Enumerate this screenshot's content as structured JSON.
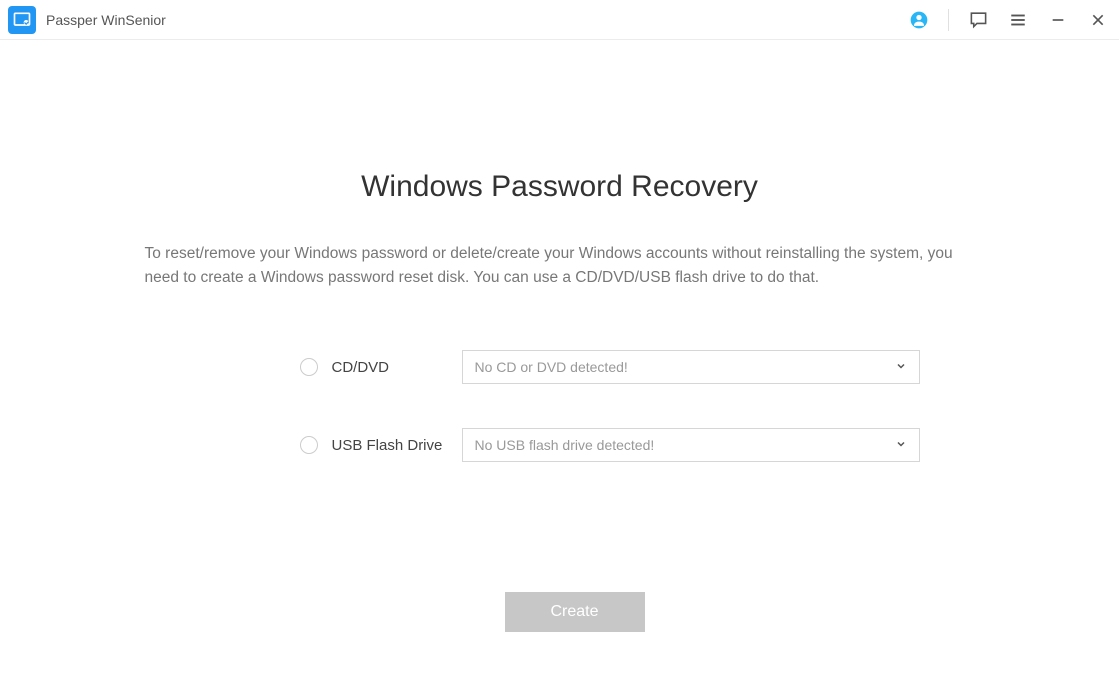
{
  "titlebar": {
    "app_name": "Passper WinSenior"
  },
  "main": {
    "heading": "Windows Password Recovery",
    "description": "To reset/remove your Windows password or delete/create your Windows accounts without reinstalling the system, you need to create a Windows password reset disk. You can use a CD/DVD/USB flash drive to do that.",
    "options": {
      "cd_dvd": {
        "label": "CD/DVD",
        "placeholder": "No CD or DVD detected!"
      },
      "usb": {
        "label": "USB Flash Drive",
        "placeholder": "No USB flash drive detected!"
      }
    },
    "create_button": "Create"
  }
}
